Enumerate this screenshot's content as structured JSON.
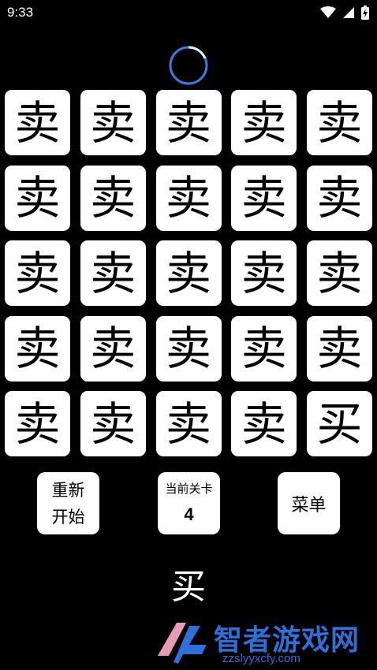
{
  "status_bar": {
    "time": "9:33",
    "icons": [
      "wifi-icon",
      "signal-icon",
      "battery-charging-icon"
    ]
  },
  "loading": {
    "icon": "loading-spinner-icon",
    "color": "#3b7be0"
  },
  "grid": {
    "rows": 5,
    "cols": 5,
    "tiles": [
      "卖",
      "卖",
      "卖",
      "卖",
      "卖",
      "卖",
      "卖",
      "卖",
      "卖",
      "卖",
      "卖",
      "卖",
      "卖",
      "卖",
      "卖",
      "卖",
      "卖",
      "卖",
      "卖",
      "卖",
      "卖",
      "卖",
      "卖",
      "卖",
      "买"
    ]
  },
  "controls": {
    "restart_line1": "重新",
    "restart_line2": "开始",
    "level_label": "当前关卡",
    "level_value": "4",
    "menu_label": "菜单"
  },
  "target_char": "买",
  "watermark": {
    "name": "智者游戏网",
    "url": "zzslyyxcfy.com",
    "color": "#2f6fd8"
  }
}
